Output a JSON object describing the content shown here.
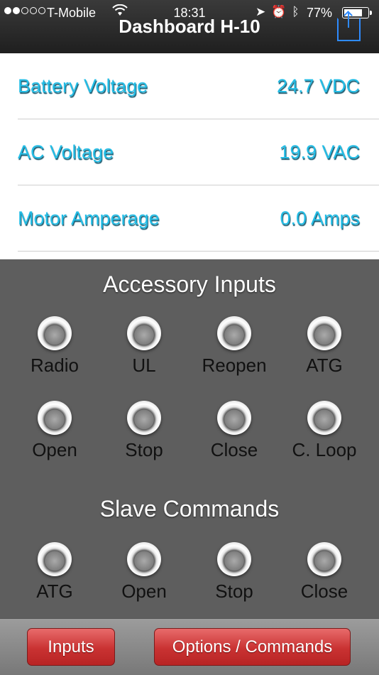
{
  "status_bar": {
    "carrier": "T-Mobile",
    "time": "18:31",
    "battery": "77%",
    "signal_dots": [
      true,
      true,
      false,
      false,
      false
    ]
  },
  "header": {
    "title": "Dashboard H-10"
  },
  "readings": [
    {
      "label": "Battery Voltage",
      "value": "24.7 VDC"
    },
    {
      "label": "AC Voltage",
      "value": "19.9 VAC"
    },
    {
      "label": "Motor Amperage",
      "value": "0.0 Amps"
    }
  ],
  "accessory_inputs": {
    "title": "Accessory Inputs",
    "items": [
      "Radio",
      "UL",
      "Reopen",
      "ATG",
      "Open",
      "Stop",
      "Close",
      "C. Loop"
    ]
  },
  "slave_commands": {
    "title": "Slave Commands",
    "items": [
      "ATG",
      "Open",
      "Stop",
      "Close"
    ]
  },
  "tabbar": {
    "inputs_label": "Inputs",
    "options_label": "Options / Commands"
  },
  "colors": {
    "reading_text": "#22bde6",
    "panel_bg": "#5e5e5e",
    "button_red": "#c93232",
    "share_blue": "#2e8bff"
  }
}
